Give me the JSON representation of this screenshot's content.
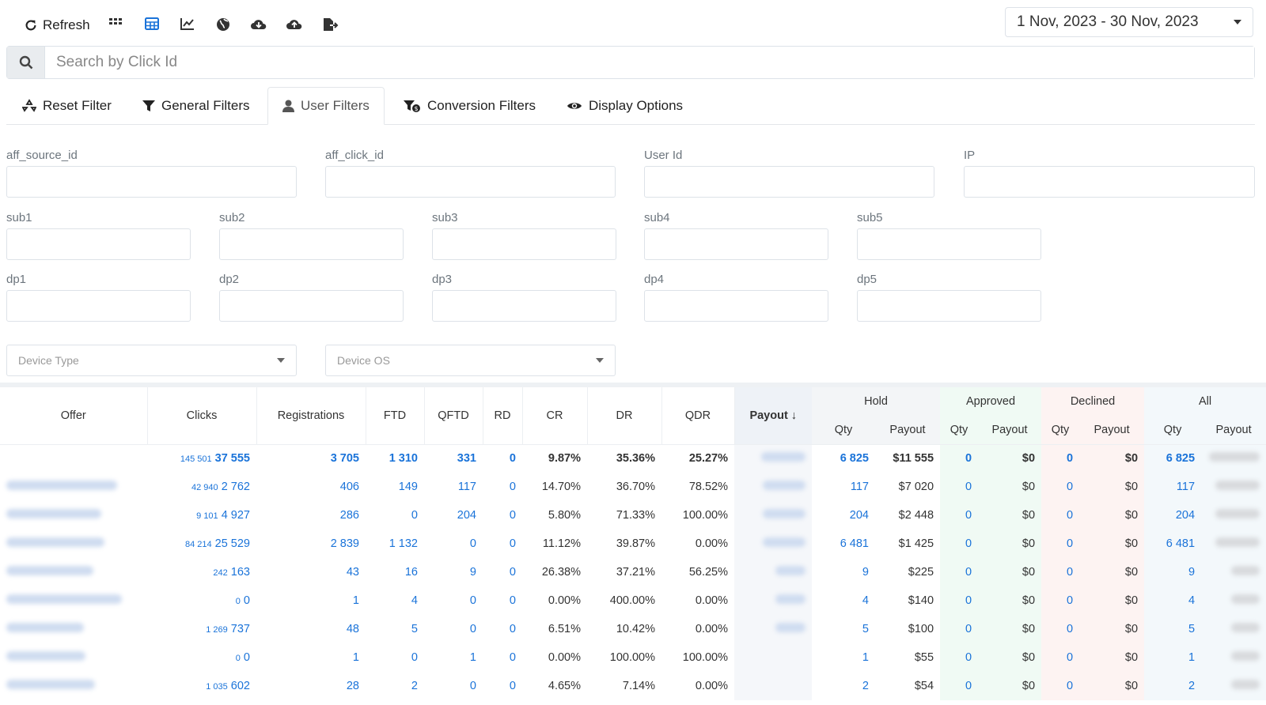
{
  "toolbar": {
    "refresh_label": "Refresh",
    "icons": [
      "grid-icon",
      "table-icon",
      "chart-icon",
      "globe-icon",
      "cloud-download-icon",
      "cloud-upload-icon",
      "export-icon"
    ],
    "date_range": "1 Nov, 2023 - 30 Nov, 2023"
  },
  "search": {
    "placeholder": "Search by Click Id"
  },
  "tabs": [
    {
      "label": "Reset Filter",
      "icon": "recycle-icon"
    },
    {
      "label": "General Filters",
      "icon": "filter-icon"
    },
    {
      "label": "User Filters",
      "icon": "user-icon"
    },
    {
      "label": "Conversion Filters",
      "icon": "filter-dollar-icon"
    },
    {
      "label": "Display Options",
      "icon": "eye-icon"
    }
  ],
  "filters": {
    "row1": [
      "aff_source_id",
      "aff_click_id",
      "User Id",
      "IP"
    ],
    "row2": [
      "sub1",
      "sub2",
      "sub3",
      "sub4",
      "sub5"
    ],
    "row3": [
      "dp1",
      "dp2",
      "dp3",
      "dp4",
      "dp5"
    ],
    "device_type": "Device Type",
    "device_os": "Device OS"
  },
  "table": {
    "headers": {
      "offer": "Offer",
      "clicks": "Clicks",
      "registrations": "Registrations",
      "ftd": "FTD",
      "qftd": "QFTD",
      "rd": "RD",
      "cr": "CR",
      "dr": "DR",
      "qdr": "QDR",
      "payout": "Payout ↓",
      "hold": "Hold",
      "approved": "Approved",
      "declined": "Declined",
      "all": "All",
      "qty": "Qty",
      "payout_sub": "Payout"
    },
    "total": {
      "clicks_small": "145 501",
      "clicks": "37 555",
      "registrations": "3 705",
      "ftd": "1 310",
      "qftd": "331",
      "rd": "0",
      "cr": "9.87%",
      "dr": "35.36%",
      "qdr": "25.27%",
      "hold_qty": "6 825",
      "hold_payout": "$11 555",
      "appr_qty": "0",
      "appr_payout": "$0",
      "decl_qty": "0",
      "decl_payout": "$0",
      "all_qty": "6 825"
    },
    "rows": [
      {
        "clicks_small": "42 940",
        "clicks": "2 762",
        "registrations": "406",
        "ftd": "149",
        "qftd": "117",
        "rd": "0",
        "cr": "14.70%",
        "dr": "36.70%",
        "qdr": "78.52%",
        "hold_qty": "117",
        "hold_payout": "$7 020",
        "appr_qty": "0",
        "appr_payout": "$0",
        "decl_qty": "0",
        "decl_payout": "$0",
        "all_qty": "117"
      },
      {
        "clicks_small": "9 101",
        "clicks": "4 927",
        "registrations": "286",
        "ftd": "0",
        "qftd": "204",
        "rd": "0",
        "cr": "5.80%",
        "dr": "71.33%",
        "qdr": "100.00%",
        "hold_qty": "204",
        "hold_payout": "$2 448",
        "appr_qty": "0",
        "appr_payout": "$0",
        "decl_qty": "0",
        "decl_payout": "$0",
        "all_qty": "204"
      },
      {
        "clicks_small": "84 214",
        "clicks": "25 529",
        "registrations": "2 839",
        "ftd": "1 132",
        "qftd": "0",
        "rd": "0",
        "cr": "11.12%",
        "dr": "39.87%",
        "qdr": "0.00%",
        "hold_qty": "6 481",
        "hold_payout": "$1 425",
        "appr_qty": "0",
        "appr_payout": "$0",
        "decl_qty": "0",
        "decl_payout": "$0",
        "all_qty": "6 481"
      },
      {
        "clicks_small": "242",
        "clicks": "163",
        "registrations": "43",
        "ftd": "16",
        "qftd": "9",
        "rd": "0",
        "cr": "26.38%",
        "dr": "37.21%",
        "qdr": "56.25%",
        "hold_qty": "9",
        "hold_payout": "$225",
        "appr_qty": "0",
        "appr_payout": "$0",
        "decl_qty": "0",
        "decl_payout": "$0",
        "all_qty": "9"
      },
      {
        "clicks_small": "0",
        "clicks": "0",
        "registrations": "1",
        "ftd": "4",
        "qftd": "0",
        "rd": "0",
        "cr": "0.00%",
        "dr": "400.00%",
        "qdr": "0.00%",
        "hold_qty": "4",
        "hold_payout": "$140",
        "appr_qty": "0",
        "appr_payout": "$0",
        "decl_qty": "0",
        "decl_payout": "$0",
        "all_qty": "4"
      },
      {
        "clicks_small": "1 269",
        "clicks": "737",
        "registrations": "48",
        "ftd": "5",
        "qftd": "0",
        "rd": "0",
        "cr": "6.51%",
        "dr": "10.42%",
        "qdr": "0.00%",
        "hold_qty": "5",
        "hold_payout": "$100",
        "appr_qty": "0",
        "appr_payout": "$0",
        "decl_qty": "0",
        "decl_payout": "$0",
        "all_qty": "5"
      },
      {
        "clicks_small": "0",
        "clicks": "0",
        "registrations": "1",
        "ftd": "0",
        "qftd": "1",
        "rd": "0",
        "cr": "0.00%",
        "dr": "100.00%",
        "qdr": "100.00%",
        "hold_qty": "1",
        "hold_payout": "$55",
        "appr_qty": "0",
        "appr_payout": "$0",
        "decl_qty": "0",
        "decl_payout": "$0",
        "all_qty": "1"
      },
      {
        "clicks_small": "1 035",
        "clicks": "602",
        "registrations": "28",
        "ftd": "2",
        "qftd": "0",
        "rd": "0",
        "cr": "4.65%",
        "dr": "7.14%",
        "qdr": "0.00%",
        "hold_qty": "2",
        "hold_payout": "$54",
        "appr_qty": "0",
        "appr_payout": "$0",
        "decl_qty": "0",
        "decl_payout": "$0",
        "all_qty": "2"
      }
    ]
  },
  "colors": {
    "link_blue": "#1a73d9",
    "approved_bg": "#f0faf4",
    "declined_bg": "#fdf3f2"
  }
}
